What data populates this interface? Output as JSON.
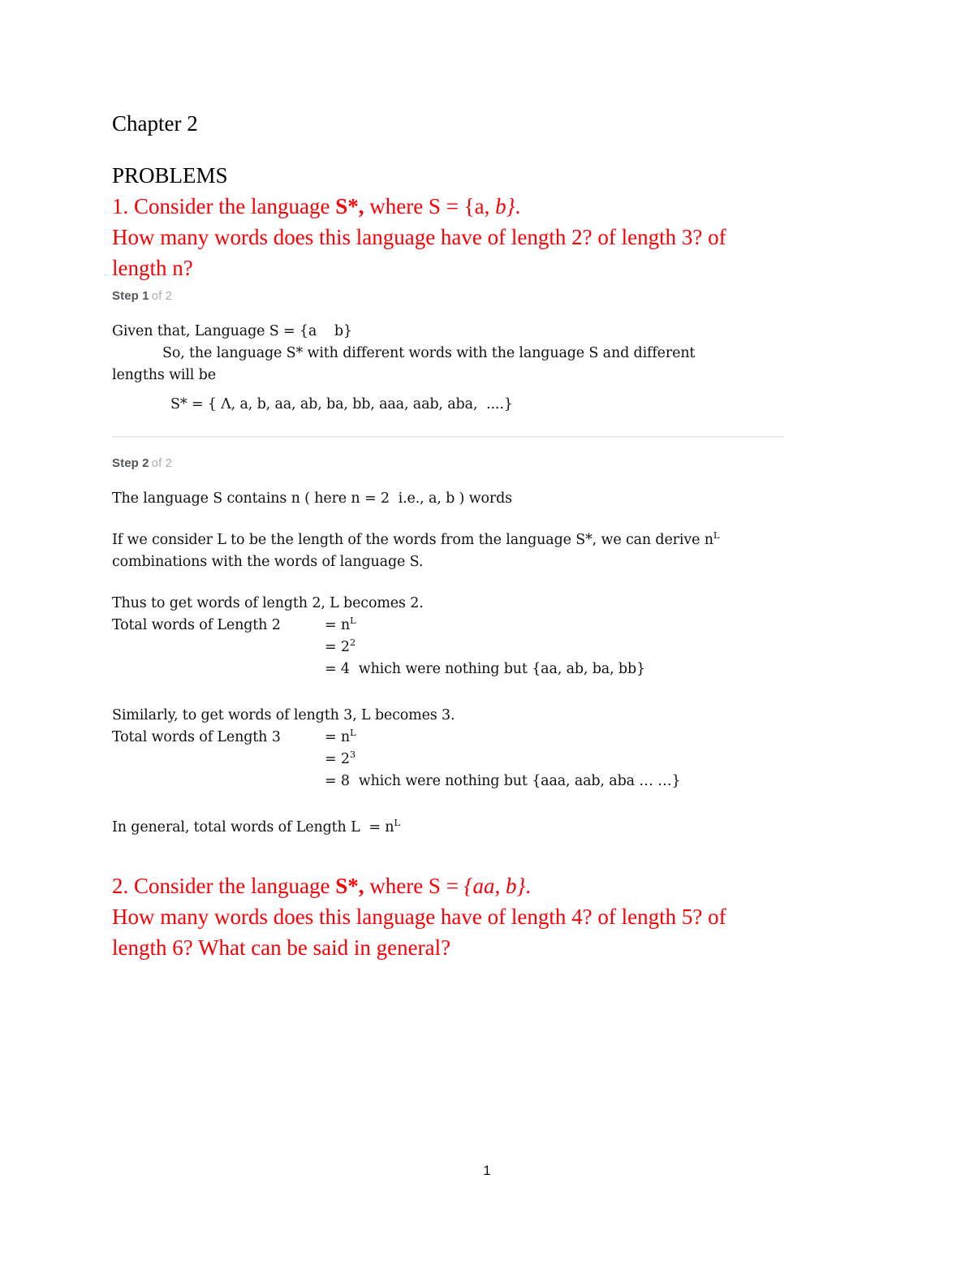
{
  "document": {
    "chapter_title": "Chapter 2",
    "problems_heading": "PROBLEMS",
    "page_number": "1",
    "accent_red": "#fb0007",
    "step_label_color": "#53565f",
    "step_sub_color": "#a9adb3",
    "divider_color": "#ececec"
  },
  "problem1": {
    "line1_pre": "1. Consider the language ",
    "line1_bold": "S*,",
    "line1_mid": " where S = {a, ",
    "line1_italic": "b}",
    "line1_post": ".",
    "line2": "How many words does this language have of length 2? of length 3? of",
    "line3": "length n?"
  },
  "step1": {
    "label": "Step 1",
    "sub": "of 2",
    "line1": "Given that, Language S = {a    b}",
    "line2": "So, the language S* with different words with the language S and different",
    "line3": "lengths will be",
    "equation": "S* = { Λ, a, b, aa, ab, ba, bb, aaa, aab, aba,  ....}"
  },
  "step2": {
    "label": "Step 2",
    "sub": "of 2",
    "line1": "The language S contains n ( here n = 2  i.e., a, b ) words",
    "line2_pre": "If we consider L to be the length of the words from the language S*, we can derive n",
    "line2_sup": "L",
    "line3": "combinations with the words of language S.",
    "block_len2": {
      "intro": "Thus to get words of length 2, L becomes 2.",
      "label": "Total words of Length 2",
      "rhs1_pre": "= n",
      "rhs1_sup": "L",
      "rhs2_pre": "= 2",
      "rhs2_sup": "2",
      "rhs3": "= 4  which were nothing but {aa, ab, ba, bb}"
    },
    "block_len3": {
      "intro": "Similarly, to get words of length 3, L becomes 3.",
      "label": "Total words of Length 3",
      "rhs1_pre": "= n",
      "rhs1_sup": "L",
      "rhs2_pre": "= 2",
      "rhs2_sup": "3",
      "rhs3": "= 8  which were nothing but {aaa, aab, aba … …}"
    },
    "general_pre": "In general, total words of Length L  = n",
    "general_sup": "L"
  },
  "problem2": {
    "line1_pre": "2. Consider the language ",
    "line1_bold": "S*,",
    "line1_mid": " where S = ",
    "line1_italic": "{aa, b}",
    "line1_post": ".",
    "line2": "How many words does this language have of length 4? of length 5? of",
    "line3": "length 6? What can be said in general?"
  }
}
